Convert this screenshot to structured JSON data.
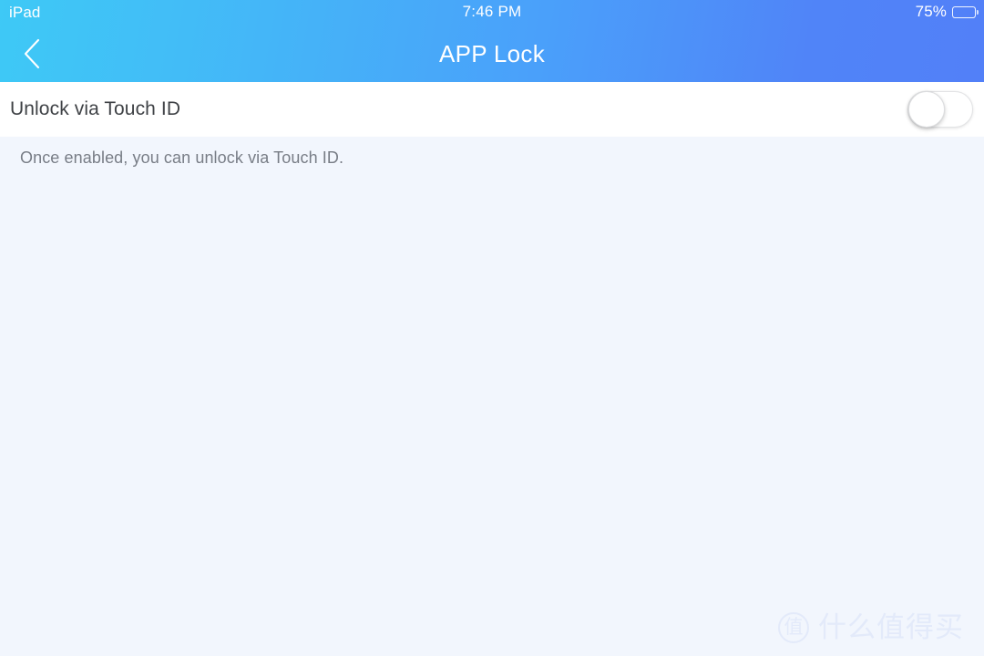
{
  "status_bar": {
    "device_label": "iPad",
    "time": "7:46 PM",
    "battery_percent_label": "75%",
    "battery_level": 75,
    "battery_icon": "battery-icon"
  },
  "nav_bar": {
    "title": "APP Lock",
    "back_icon": "chevron-left-icon"
  },
  "settings": {
    "row": {
      "label": "Unlock via Touch ID",
      "toggle_state": "off",
      "description": "Once enabled, you can unlock via Touch ID."
    }
  },
  "watermark": {
    "badge_glyph": "值",
    "text": "什么值得买"
  },
  "colors": {
    "header_gradient_start": "#3ec9f6",
    "header_gradient_end": "#5280f8",
    "page_background": "#f2f6fd",
    "row_background": "#ffffff",
    "label_text": "#3f4246",
    "description_text": "#787d86",
    "status_text": "#ffffff",
    "watermark": "#e3eafa"
  }
}
